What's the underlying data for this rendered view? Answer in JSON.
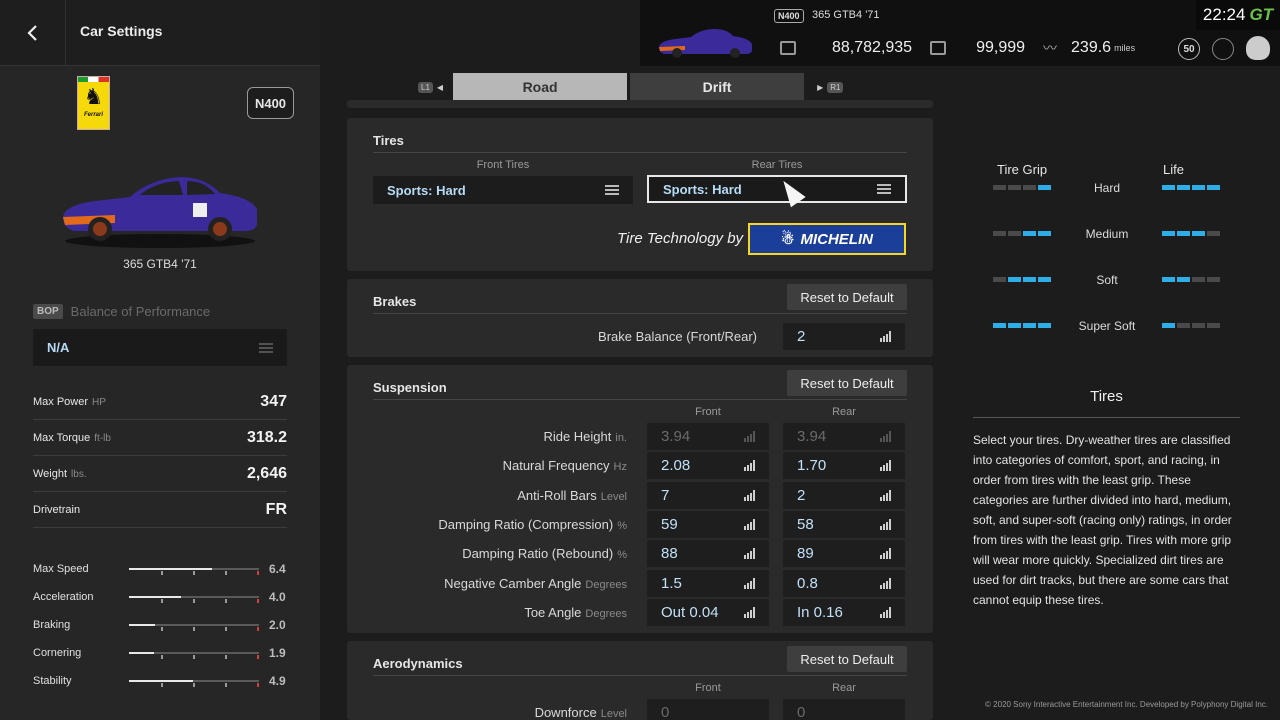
{
  "header": {
    "title": "Car Settings",
    "badge": "N400",
    "car_name": "365 GTB4 '71",
    "credits": "88,782,935",
    "mileage_points": "99,999",
    "distance": "239.6",
    "distance_unit": "miles",
    "level": "50",
    "clock": "22:24",
    "gt_mark": "GT"
  },
  "sidebar": {
    "logo_text": "Ferrari",
    "class_badge": "N400",
    "car_name": "365 GTB4 '71",
    "bop_badge": "BOP",
    "bop_label": "Balance of Performance",
    "bop_value": "N/A",
    "specs": [
      {
        "label": "Max Power",
        "unit": "HP",
        "value": "347"
      },
      {
        "label": "Max Torque",
        "unit": "ft-lb",
        "value": "318.2"
      },
      {
        "label": "Weight",
        "unit": "lbs.",
        "value": "2,646"
      },
      {
        "label": "Drivetrain",
        "unit": "",
        "value": "FR"
      }
    ],
    "stats": [
      {
        "label": "Max Speed",
        "value": "6.4",
        "level": 0.64
      },
      {
        "label": "Acceleration",
        "value": "4.0",
        "level": 0.4
      },
      {
        "label": "Braking",
        "value": "2.0",
        "level": 0.2
      },
      {
        "label": "Cornering",
        "value": "1.9",
        "level": 0.19
      },
      {
        "label": "Stability",
        "value": "4.9",
        "level": 0.49
      }
    ]
  },
  "tabs": {
    "left_btn": "L1",
    "right_btn": "R1",
    "road": "Road",
    "drift": "Drift"
  },
  "tires": {
    "title": "Tires",
    "front_label": "Front Tires",
    "rear_label": "Rear Tires",
    "front_value": "Sports: Hard",
    "rear_value": "Sports: Hard",
    "tech_text": "Tire Technology by",
    "brand": "MICHELIN"
  },
  "brakes": {
    "title": "Brakes",
    "reset": "Reset to Default",
    "label": "Brake Balance (Front/Rear)",
    "value": "2"
  },
  "suspension": {
    "title": "Suspension",
    "reset": "Reset to Default",
    "front": "Front",
    "rear": "Rear",
    "rows": [
      {
        "label": "Ride Height",
        "unit": "in.",
        "front": "3.94",
        "rear": "3.94",
        "dim": true
      },
      {
        "label": "Natural Frequency",
        "unit": "Hz",
        "front": "2.08",
        "rear": "1.70",
        "dim": false
      },
      {
        "label": "Anti-Roll Bars",
        "unit": "Level",
        "front": "7",
        "rear": "2",
        "dim": false
      },
      {
        "label": "Damping Ratio (Compression)",
        "unit": "%",
        "front": "59",
        "rear": "58",
        "dim": false
      },
      {
        "label": "Damping Ratio (Rebound)",
        "unit": "%",
        "front": "88",
        "rear": "89",
        "dim": false
      },
      {
        "label": "Negative Camber Angle",
        "unit": "Degrees",
        "front": "1.5",
        "rear": "0.8",
        "dim": false
      },
      {
        "label": "Toe Angle",
        "unit": "Degrees",
        "front": "Out 0.04",
        "rear": "In 0.16",
        "dim": false
      }
    ]
  },
  "aero": {
    "title": "Aerodynamics",
    "reset": "Reset to Default",
    "front": "Front",
    "rear": "Rear",
    "label": "Downforce",
    "unit": "Level",
    "front_value": "0",
    "rear_value": "0"
  },
  "grip_chart": {
    "grip_head": "Tire Grip",
    "life_head": "Life",
    "rows": [
      {
        "name": "Hard",
        "grip": 1,
        "life": 4
      },
      {
        "name": "Medium",
        "grip": 2,
        "life": 3
      },
      {
        "name": "Soft",
        "grip": 3,
        "life": 2
      },
      {
        "name": "Super Soft",
        "grip": 4,
        "life": 1
      }
    ]
  },
  "description": {
    "title": "Tires",
    "text": "Select your tires. Dry-weather tires are classified into categories of comfort, sport, and racing, in order from tires with the least grip. These categories are further divided into hard, medium, soft, and super-soft (racing only) ratings, in order from tires with the least grip. Tires with more grip will wear more quickly. Specialized dirt tires are used for dirt tracks, but there are some cars that cannot equip these tires."
  },
  "copyright": "© 2020 Sony Interactive Entertainment Inc. Developed by Polyphony Digital Inc.",
  "colors": {
    "accent": "#2eaee6",
    "value": "#c2e0f7",
    "panel": "#2a2a2a"
  }
}
